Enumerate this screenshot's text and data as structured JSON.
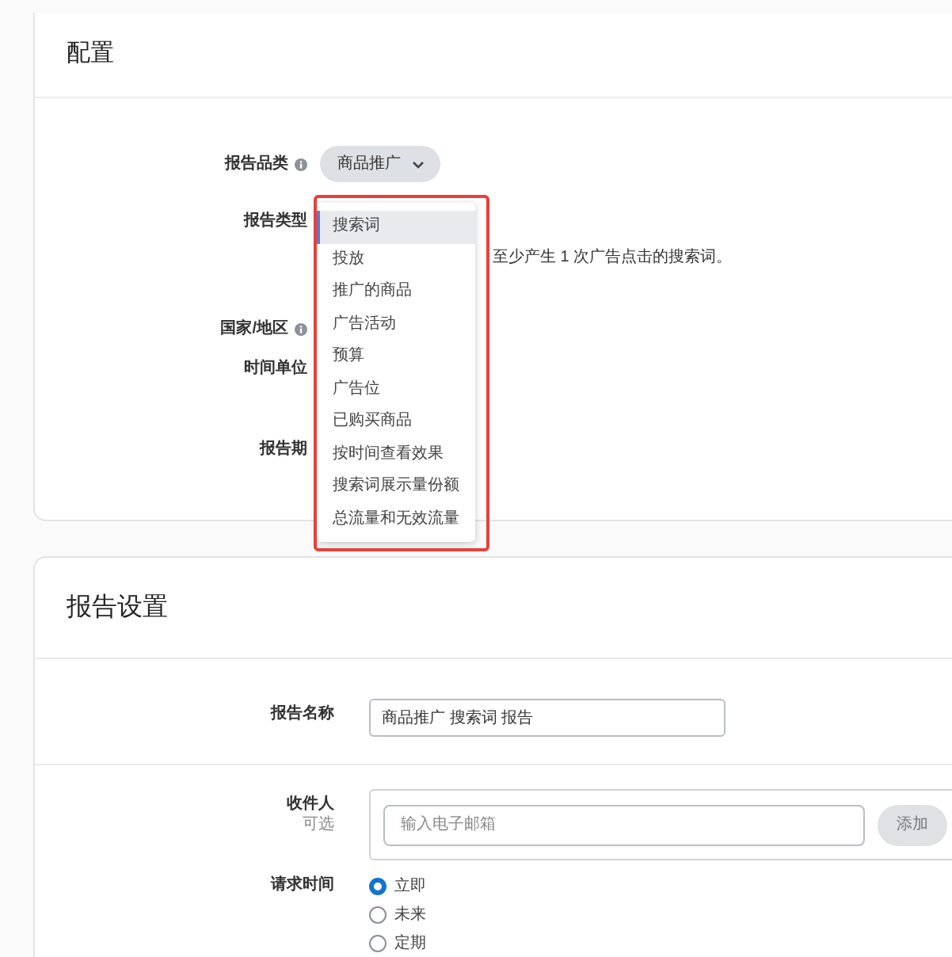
{
  "config": {
    "title": "配置",
    "fields": [
      {
        "kind": "select",
        "label": "报告品类",
        "info": true,
        "value": "商品推广"
      },
      {
        "kind": "menu",
        "label": "报告类型",
        "info": false,
        "outlined": true,
        "options": [
          {
            "label": "搜索词",
            "selected": true
          },
          {
            "label": "投放",
            "selected": false
          },
          {
            "label": "推广的商品",
            "selected": false
          },
          {
            "label": "广告活动",
            "selected": false
          },
          {
            "label": "预算",
            "selected": false
          },
          {
            "label": "广告位",
            "selected": false
          },
          {
            "label": "已购买商品",
            "selected": false
          },
          {
            "label": "按时间查看效果",
            "selected": false
          },
          {
            "label": "搜索词展示量份额",
            "selected": false
          },
          {
            "label": "总流量和无效流量",
            "selected": false
          }
        ],
        "description": "至少产生 1 次广告点击的搜索词。"
      },
      {
        "kind": "covered",
        "label": "国家/地区",
        "info": true
      },
      {
        "kind": "covered",
        "label": "时间单位",
        "info": false
      },
      {
        "kind": "covered",
        "label": "报告期",
        "info": false
      }
    ]
  },
  "report_settings": {
    "title": "报告设置",
    "report_name": {
      "label": "报告名称",
      "value": "商品推广 搜索词 报告"
    },
    "recipients": {
      "label": "收件人",
      "hint": "可选",
      "placeholder": "输入电子邮箱",
      "button": "添加"
    },
    "request_time": {
      "label": "请求时间",
      "options": [
        {
          "label": "立即",
          "selected": true
        },
        {
          "label": "未来",
          "selected": false
        },
        {
          "label": "定期",
          "selected": false
        }
      ]
    }
  }
}
